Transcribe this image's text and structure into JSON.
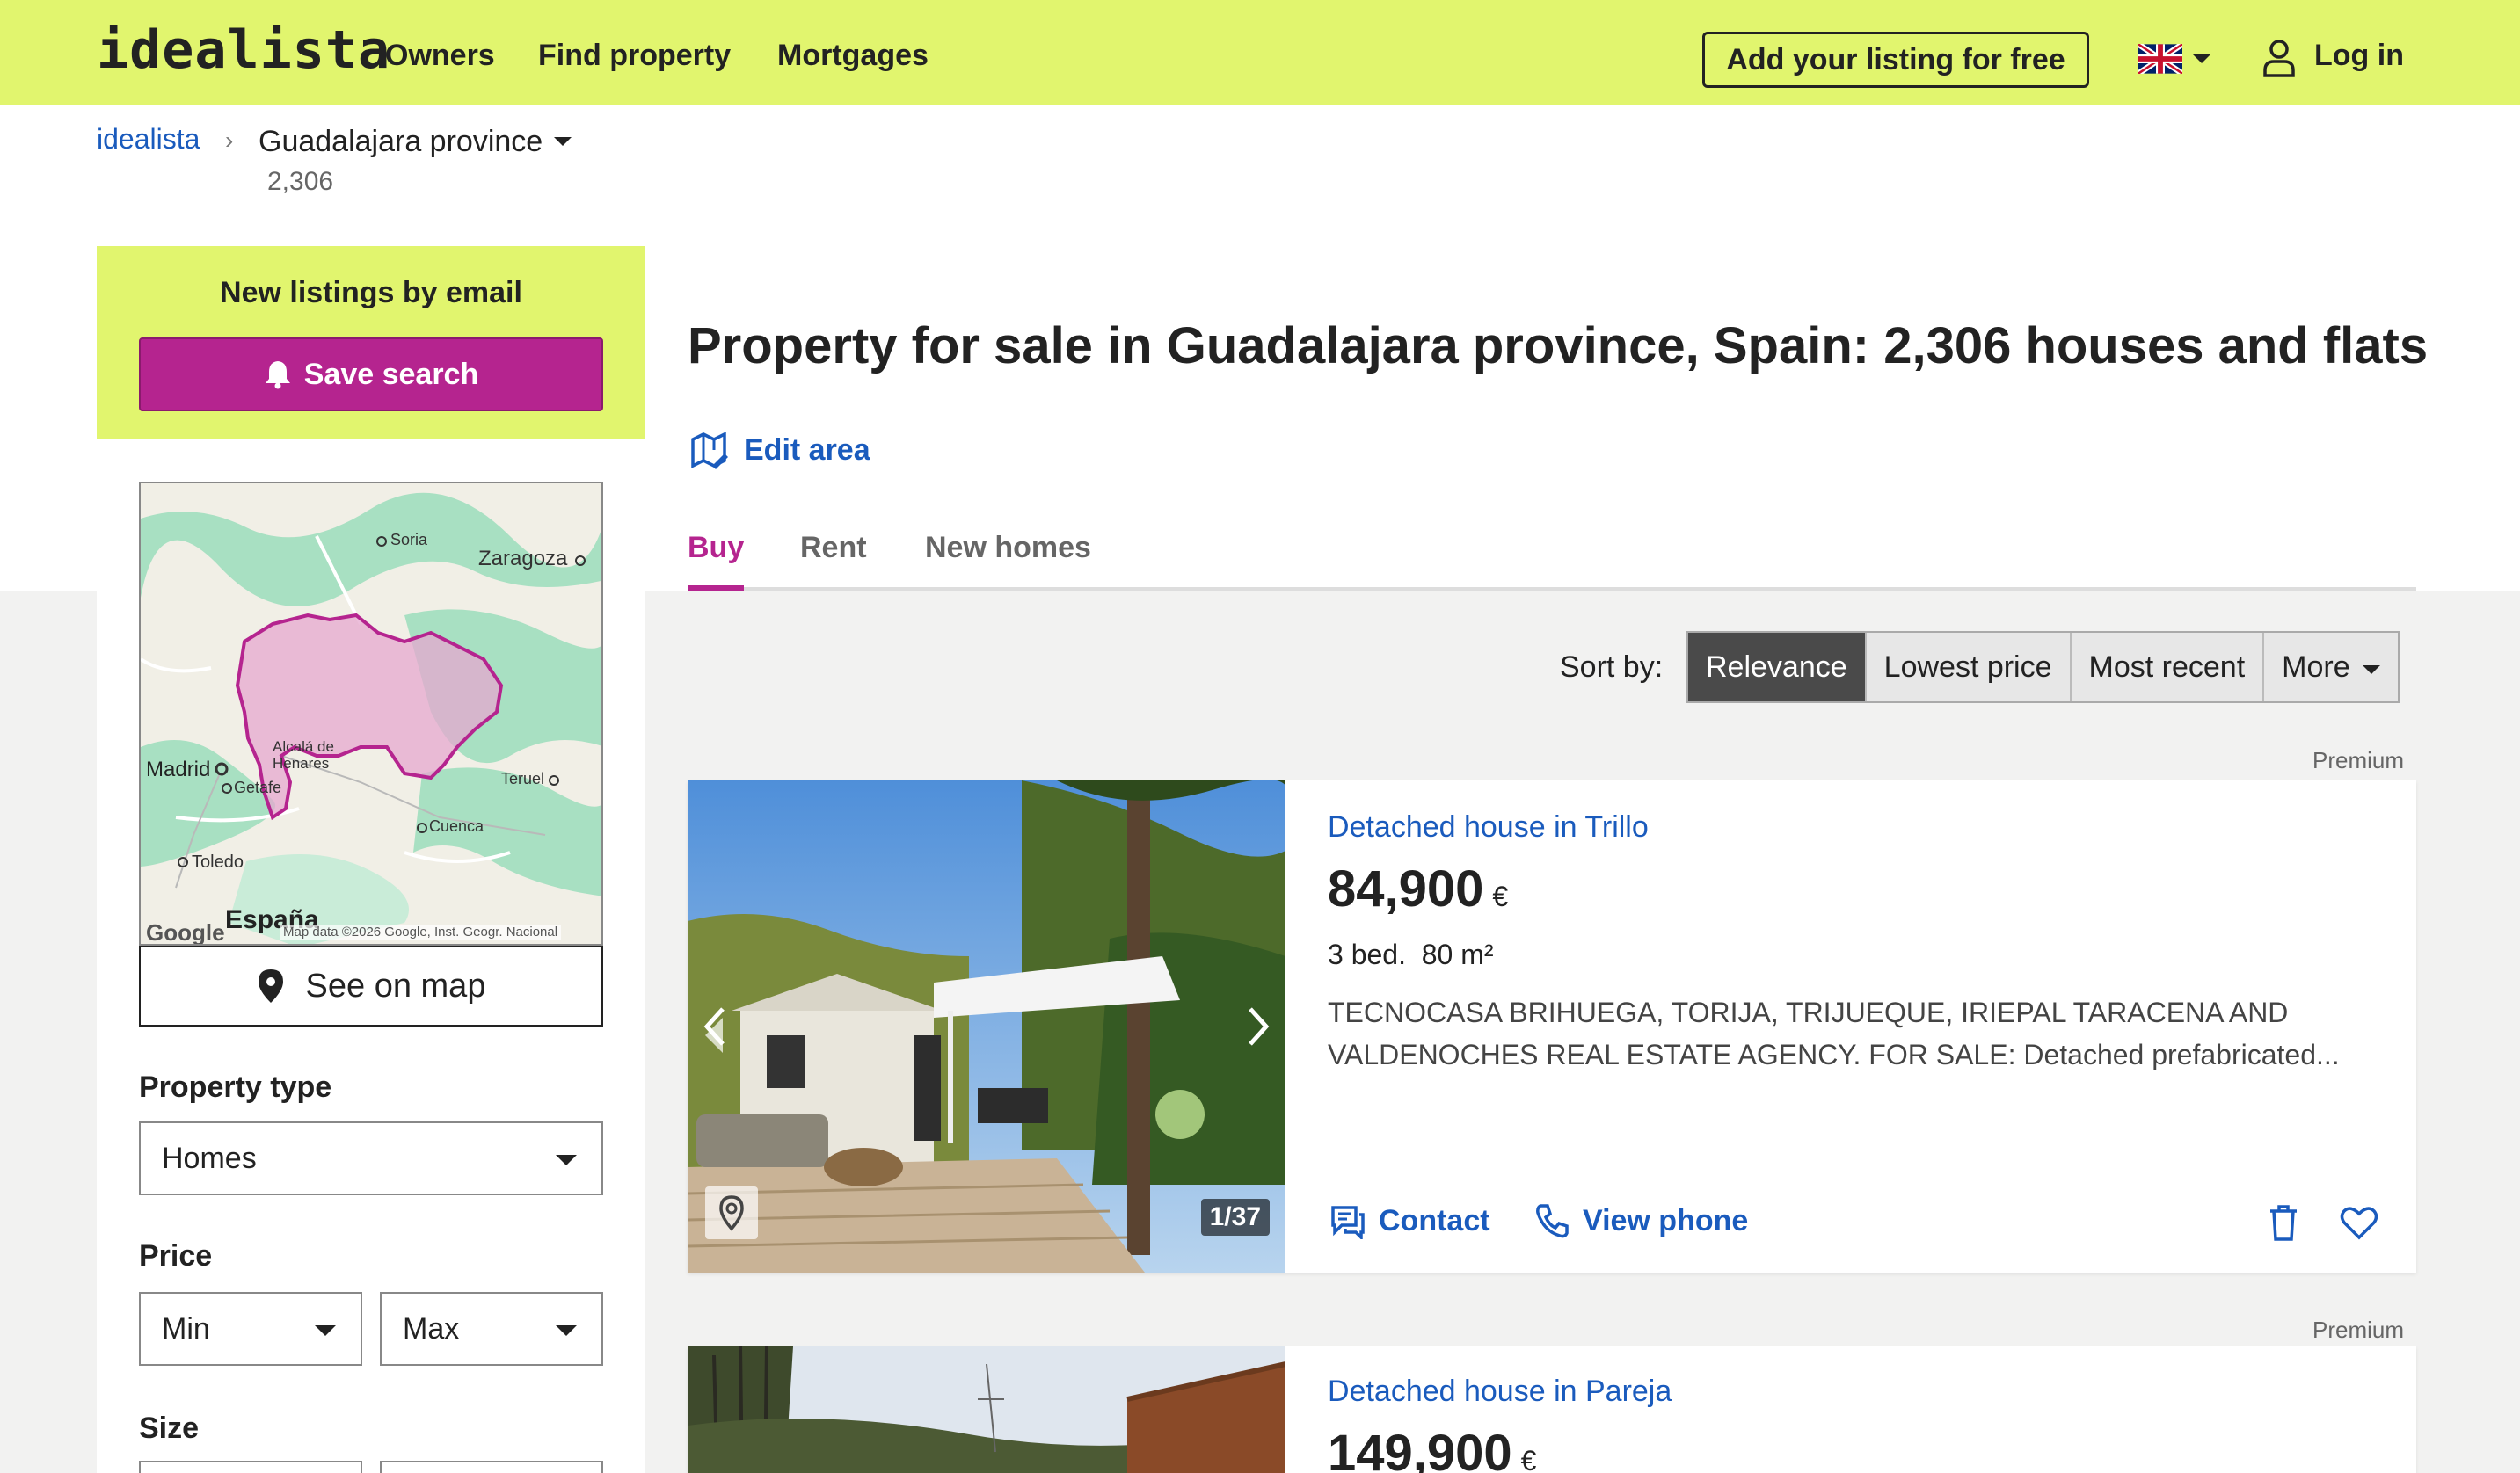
{
  "header": {
    "logo": "idealista",
    "nav": [
      "Owners",
      "Find property",
      "Mortgages"
    ],
    "add_listing": "Add your listing for free",
    "login": "Log in"
  },
  "breadcrumb": {
    "home": "idealista",
    "separator": "›",
    "current": "Guadalajara province",
    "count": "2,306"
  },
  "sidebar": {
    "email_title": "New listings by email",
    "save_search": "Save search",
    "map": {
      "labels": [
        "Soria",
        "Zaragoza",
        "Madrid",
        "Alcalá de Henares",
        "Getafe",
        "Teruel",
        "Cuenca",
        "Toledo",
        "España"
      ],
      "attribution": "Map data ©2026 Google, Inst. Geogr. Nacional",
      "google": "Google"
    },
    "see_on_map": "See on map",
    "property_type_label": "Property type",
    "property_type_value": "Homes",
    "price_label": "Price",
    "price_min": "Min",
    "price_max": "Max",
    "size_label": "Size"
  },
  "main": {
    "title": "Property for sale in Guadalajara province, Spain: 2,306 houses and flats",
    "edit_area": "Edit area",
    "tabs": [
      "Buy",
      "Rent",
      "New homes"
    ],
    "active_tab": "Buy",
    "sort_label": "Sort by:",
    "sort_options": [
      "Relevance",
      "Lowest price",
      "Most recent",
      "More"
    ],
    "sort_active": "Relevance"
  },
  "listings": [
    {
      "badge": "Premium",
      "title": "Detached house in Trillo",
      "price": "84,900",
      "currency": "€",
      "details": "3 bed.  80 m²",
      "description": "TECNOCASA BRIHUEGA, TORIJA, TRIJUEQUE, IRIEPAL TARACENA AND VALDENOCHES REAL ESTATE AGENCY. FOR SALE: Detached prefabricated...",
      "photos": "1/37",
      "contact": "Contact",
      "view_phone": "View phone"
    },
    {
      "badge": "Premium",
      "title": "Detached house in Pareja",
      "price": "149,900",
      "currency": "€"
    }
  ],
  "colors": {
    "brand_yellow": "#e1f56e",
    "brand_magenta": "#b5248f",
    "link_blue": "#1a5bbd"
  }
}
